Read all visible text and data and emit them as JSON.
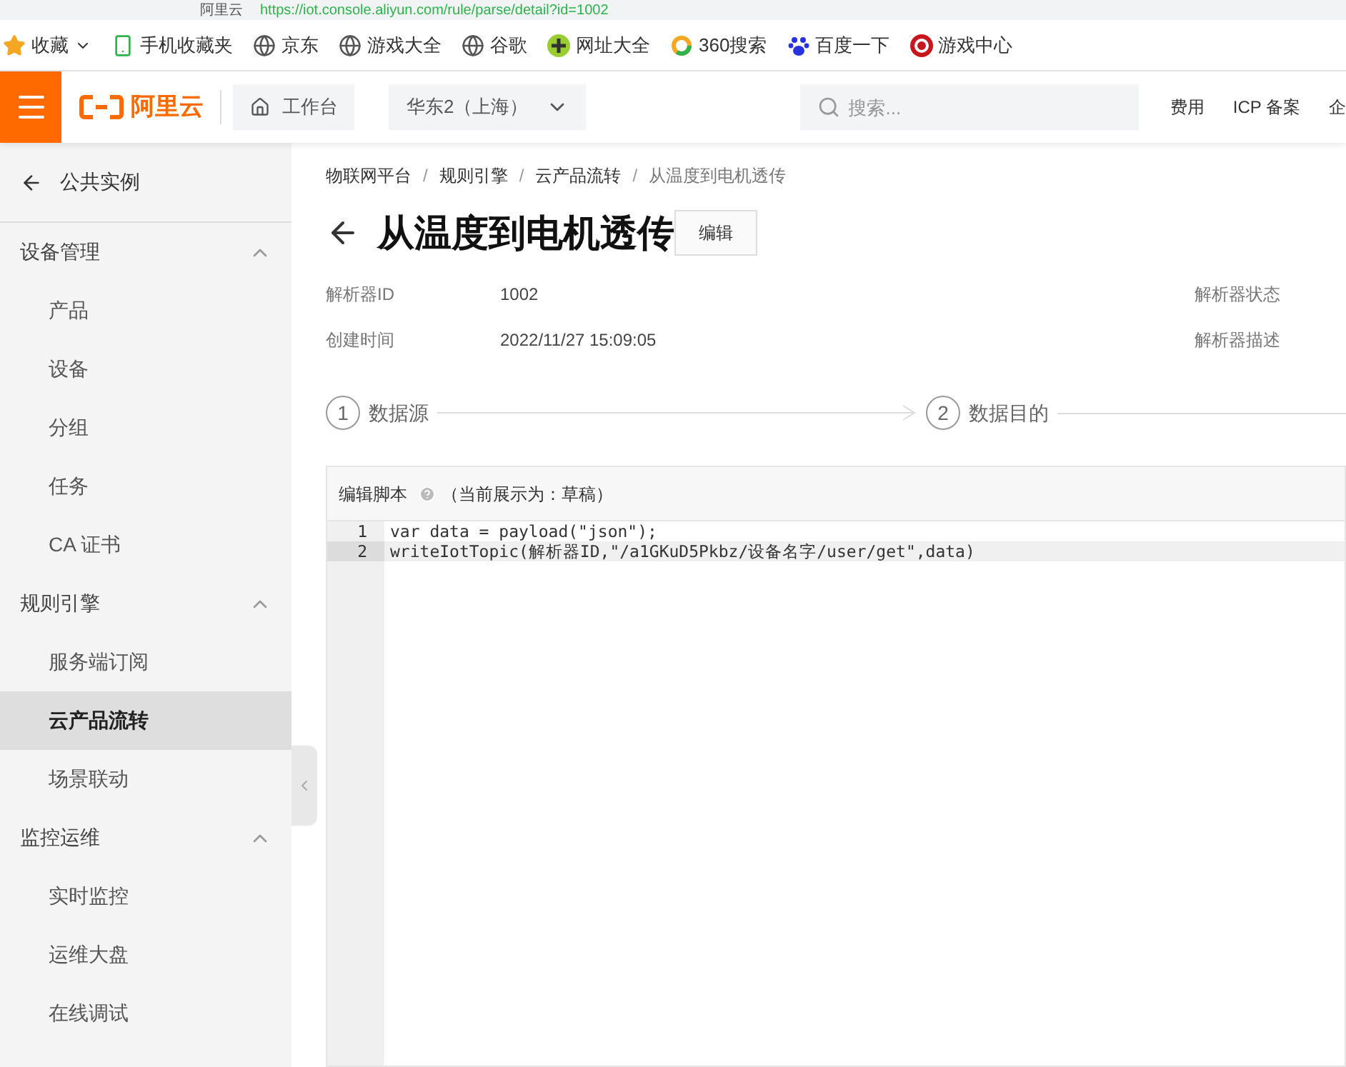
{
  "browser": {
    "tab_title": "阿里云",
    "url": "https://iot.console.aliyun.com/rule/parse/detail?id=1002"
  },
  "bookmarks": [
    {
      "label": "收藏",
      "kind": "star"
    },
    {
      "label": "手机收藏夹",
      "kind": "phone"
    },
    {
      "label": "京东",
      "kind": "globe"
    },
    {
      "label": "游戏大全",
      "kind": "globe"
    },
    {
      "label": "谷歌",
      "kind": "globe"
    },
    {
      "label": "网址大全",
      "kind": "plus"
    },
    {
      "label": "360搜索",
      "kind": "ring"
    },
    {
      "label": "百度一下",
      "kind": "paw"
    },
    {
      "label": "游戏中心",
      "kind": "game"
    }
  ],
  "header": {
    "logo": "阿里云",
    "workbench": "工作台",
    "region": "华东2（上海）",
    "search": {
      "placeholder": "搜索..."
    },
    "links": [
      "费用",
      "ICP 备案",
      "企"
    ]
  },
  "sidebar": {
    "back": "公共实例",
    "groups": [
      {
        "label": "设备管理",
        "expanded": true,
        "items": [
          {
            "label": "产品",
            "selected": false
          },
          {
            "label": "设备",
            "selected": false
          },
          {
            "label": "分组",
            "selected": false
          },
          {
            "label": "任务",
            "selected": false
          },
          {
            "label": "CA 证书",
            "selected": false
          }
        ]
      },
      {
        "label": "规则引擎",
        "expanded": true,
        "items": [
          {
            "label": "服务端订阅",
            "selected": false
          },
          {
            "label": "云产品流转",
            "selected": true
          },
          {
            "label": "场景联动",
            "selected": false
          }
        ]
      },
      {
        "label": "监控运维",
        "expanded": true,
        "items": [
          {
            "label": "实时监控",
            "selected": false
          },
          {
            "label": "运维大盘",
            "selected": false
          },
          {
            "label": "在线调试",
            "selected": false
          }
        ]
      }
    ]
  },
  "breadcrumb": [
    "物联网平台",
    "规则引擎",
    "云产品流转",
    "从温度到电机透传"
  ],
  "breadcrumb_separator": "/",
  "title": "从温度到电机透传",
  "edit_button": "编辑",
  "details": [
    {
      "label": "解析器ID",
      "value": "1002",
      "right_label": "解析器状态"
    },
    {
      "label": "创建时间",
      "value": "2022/11/27 15:09:05",
      "right_label": "解析器描述"
    }
  ],
  "steps": [
    {
      "number": "1",
      "label": "数据源"
    },
    {
      "number": "2",
      "label": "数据目的"
    }
  ],
  "editor": {
    "title": "编辑脚本",
    "note": "（当前展示为：草稿）",
    "lines": [
      {
        "number": "1",
        "code": "var data = payload(\"json\");",
        "selected": false
      },
      {
        "number": "2",
        "code": "writeIotTopic(解析器ID,\"/a1GKuD5Pkbz/设备名字/user/get\",data)",
        "selected": true
      }
    ]
  }
}
